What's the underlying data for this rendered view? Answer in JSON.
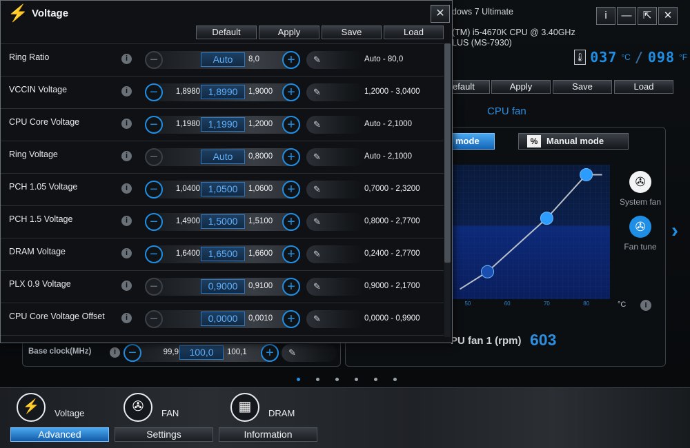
{
  "background_window": {
    "sysinfo": {
      "os": "dows 7 Ultimate",
      "cpu": "(TM) i5-4670K CPU @ 3.40GHz",
      "board": "LUS (MS-7930)"
    },
    "title_buttons": {
      "info": "i",
      "minimize": "—",
      "restore": "⇱",
      "close": "✕"
    },
    "temps": {
      "cpu_value": "037",
      "cpu_unit": "°C",
      "sys_value": "098",
      "sys_unit": "°F"
    },
    "toolbar": {
      "default_label": "efault",
      "apply_label": "Apply",
      "save_label": "Save",
      "load_label": "Load"
    },
    "fan": {
      "title": "CPU fan",
      "mode_auto_label": "mode",
      "mode_manual_label": "Manual mode",
      "mode_manual_icon": "%",
      "system_fan_label": "System fan",
      "fan_tune_label": "Fan tune",
      "temp_unit": "°C",
      "rpm_label": "PU fan 1 (rpm)",
      "rpm_value": "603"
    },
    "base_clock": {
      "label": "Base clock(MHz)",
      "low": "99,9",
      "current": "100,0",
      "high": "100,1"
    },
    "pager": {
      "count": 6,
      "active_index": 0
    },
    "nav": {
      "voltage_label": "Voltage",
      "fan_label": "FAN",
      "dram_label": "DRAM",
      "advanced_label": "Advanced",
      "settings_label": "Settings",
      "information_label": "Information"
    }
  },
  "chart_data": {
    "type": "line",
    "x": [
      48,
      55,
      70,
      80,
      84
    ],
    "y": [
      8,
      22,
      65,
      100,
      100
    ],
    "xticks": [
      "50",
      "60",
      "70",
      "80"
    ],
    "xlim": [
      46,
      86
    ],
    "ylim": [
      0,
      108
    ],
    "grid": true,
    "colors": {
      "line": "#b8c0c8",
      "point_active": "#2d9cff",
      "point_dark": "#1a4fb0"
    }
  },
  "voltage_dialog": {
    "title": "Voltage",
    "close_glyph": "✕",
    "toolbar": {
      "default_label": "Default",
      "apply_label": "Apply",
      "save_label": "Save",
      "load_label": "Load"
    },
    "rows": [
      {
        "label": "Ring Ratio",
        "low": "",
        "current": "Auto",
        "high": "8,0",
        "range": "Auto - 80,0",
        "minus_enabled": false
      },
      {
        "label": "VCCIN Voltage",
        "low": "1,8980",
        "current": "1,8990",
        "high": "1,9000",
        "range": "1,2000 - 3,0400",
        "minus_enabled": true
      },
      {
        "label": "CPU Core Voltage",
        "low": "1,1980",
        "current": "1,1990",
        "high": "1,2000",
        "range": "Auto - 2,1000",
        "minus_enabled": true
      },
      {
        "label": "Ring Voltage",
        "low": "",
        "current": "Auto",
        "high": "0,8000",
        "range": "Auto - 2,1000",
        "minus_enabled": false
      },
      {
        "label": "PCH 1.05 Voltage",
        "low": "1,0400",
        "current": "1,0500",
        "high": "1,0600",
        "range": "0,7000 - 2,3200",
        "minus_enabled": true
      },
      {
        "label": "PCH 1.5 Voltage",
        "low": "1,4900",
        "current": "1,5000",
        "high": "1,5100",
        "range": "0,8000 - 2,7700",
        "minus_enabled": true
      },
      {
        "label": "DRAM Voltage",
        "low": "1,6400",
        "current": "1,6500",
        "high": "1,6600",
        "range": "0,2400 - 2,7700",
        "minus_enabled": true
      },
      {
        "label": "PLX 0.9 Voltage",
        "low": "",
        "current": "0,9000",
        "high": "0,9100",
        "range": "0,9000 - 2,1700",
        "minus_enabled": false
      },
      {
        "label": "CPU Core Voltage Offset",
        "low": "",
        "current": "0,0000",
        "high": "0,0010",
        "range": "0,0000 - 0,9900",
        "minus_enabled": false
      }
    ],
    "info_glyph": "i",
    "minus_glyph": "−",
    "plus_glyph": "+",
    "pen_glyph": "✎"
  }
}
